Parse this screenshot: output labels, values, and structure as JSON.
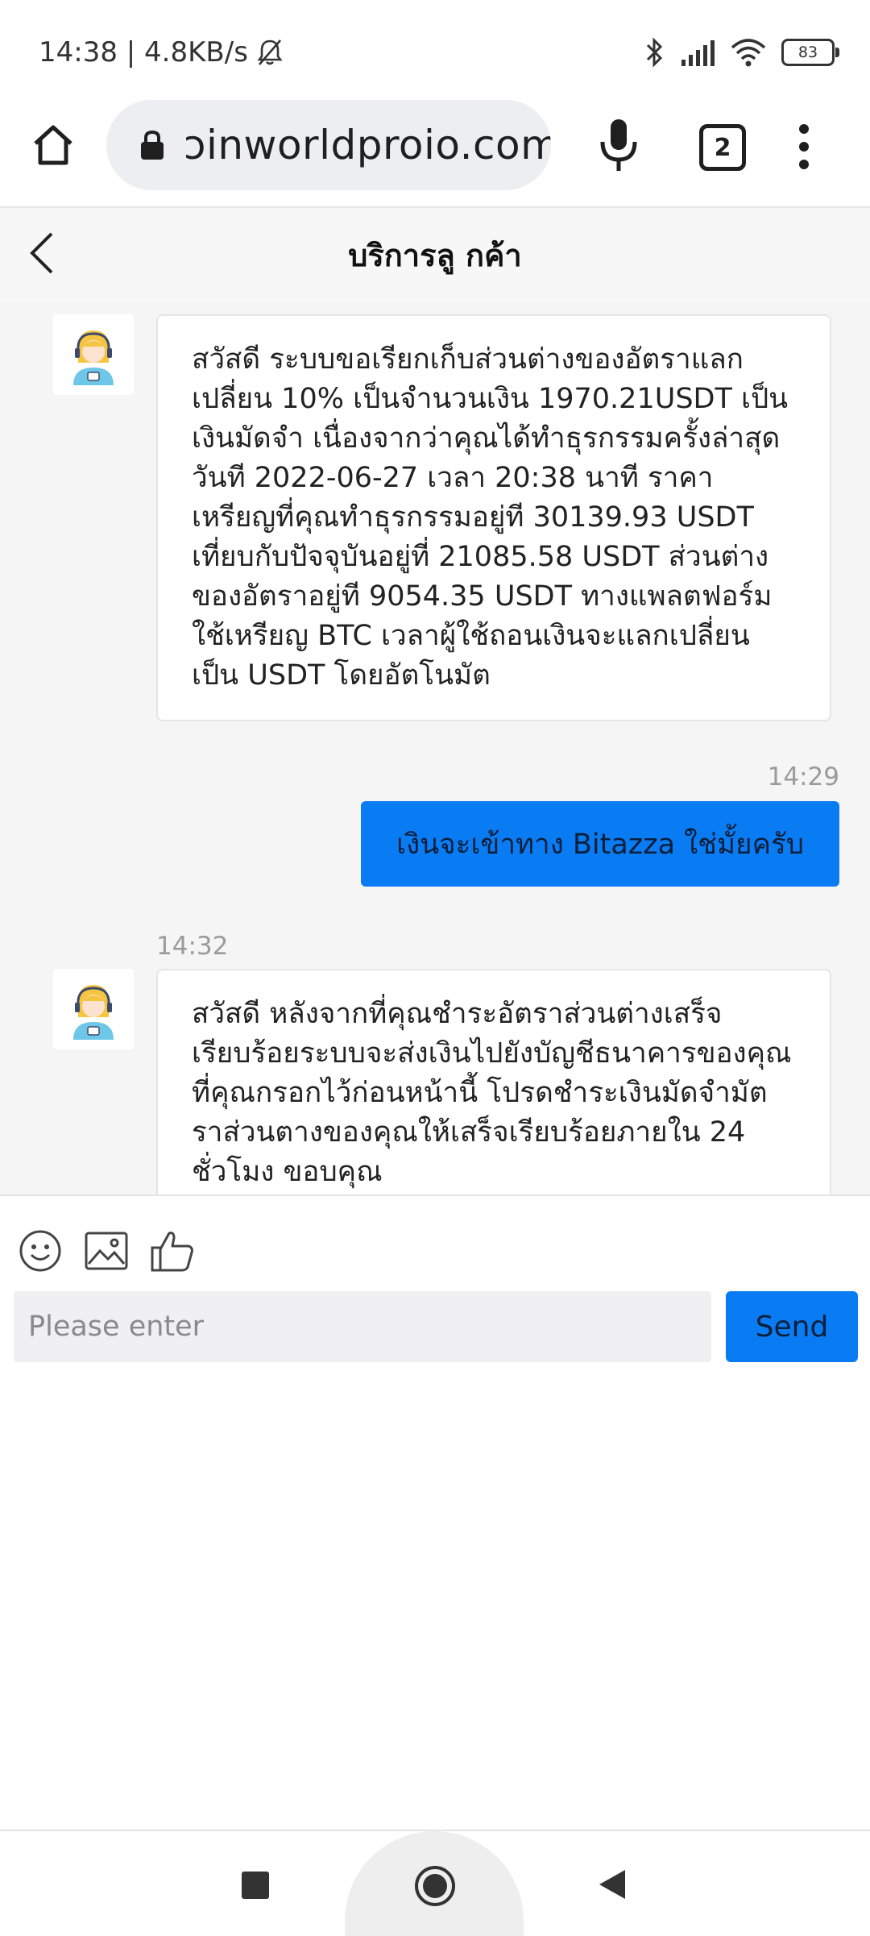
{
  "status_bar": {
    "time_speed": "14:38 | 4.8KB/s",
    "battery": "83"
  },
  "browser": {
    "url": "ɔinworldproio.com",
    "tab_count": "2"
  },
  "chat": {
    "title": "บริการลู กค้า",
    "messages": [
      {
        "direction": "incoming",
        "text": "สวัสดี ระบบขอเรียกเก็บส่วนต่างของอัตราแลกเปลี่ยน 10% เป็นจำนวนเงิน 1970.21USDT เป็นเงินมัดจำ เนื่องจากว่าคุณได้ทำธุรกรรมครั้งล่าสุดวันที 2022-06-27 เวลา 20:38 นาที ราคาเหรียญที่คุณทำธุรกรรมอยู่ที 30139.93 USDT เที่ยบกับปัจจุบันอยู่ที่ 21085.58 USDT ส่วนต่างของอัตราอยู่ที 9054.35 USDT ทางแพลตฟอร์มใช้เหรียญ BTC เวลาผู้ใช้ถอนเงินจะแลกเปลี่ยนเป็น USDT โดยอัตโนมัต"
      },
      {
        "direction": "outgoing",
        "time": "14:29",
        "text": "เงินจะเข้าทาง Bitazza ใช่มั้ยครับ"
      },
      {
        "direction": "incoming",
        "time": "14:32",
        "text": "สวัสดี หลังจากที่คุณชำระอัตราส่วนต่างเสร็จเรียบร้อยระบบจะส่งเงินไปยังบัญชีธนาคารของคุณที่คุณกรอกไว้ก่อนหน้านี้ โปรดชำระเงินมัดจำมัตราส่วนตางของคุณให้เสร็จเรียบร้อยภายใน 24 ชั่วโมง ขอบคุณ"
      }
    ]
  },
  "composer": {
    "placeholder": "Please enter",
    "send_label": "Send"
  },
  "colors": {
    "accent": "#0a7cf3",
    "chat_bg": "#f5f5f5"
  },
  "icons": [
    "bell-off-icon",
    "bluetooth-icon",
    "signal-icon",
    "wifi-icon",
    "battery-icon",
    "home-icon",
    "lock-icon",
    "mic-icon",
    "tabs-icon",
    "menu-icon",
    "back-icon",
    "support-agent-avatar",
    "emoji-icon",
    "image-icon",
    "thumbs-up-icon"
  ]
}
